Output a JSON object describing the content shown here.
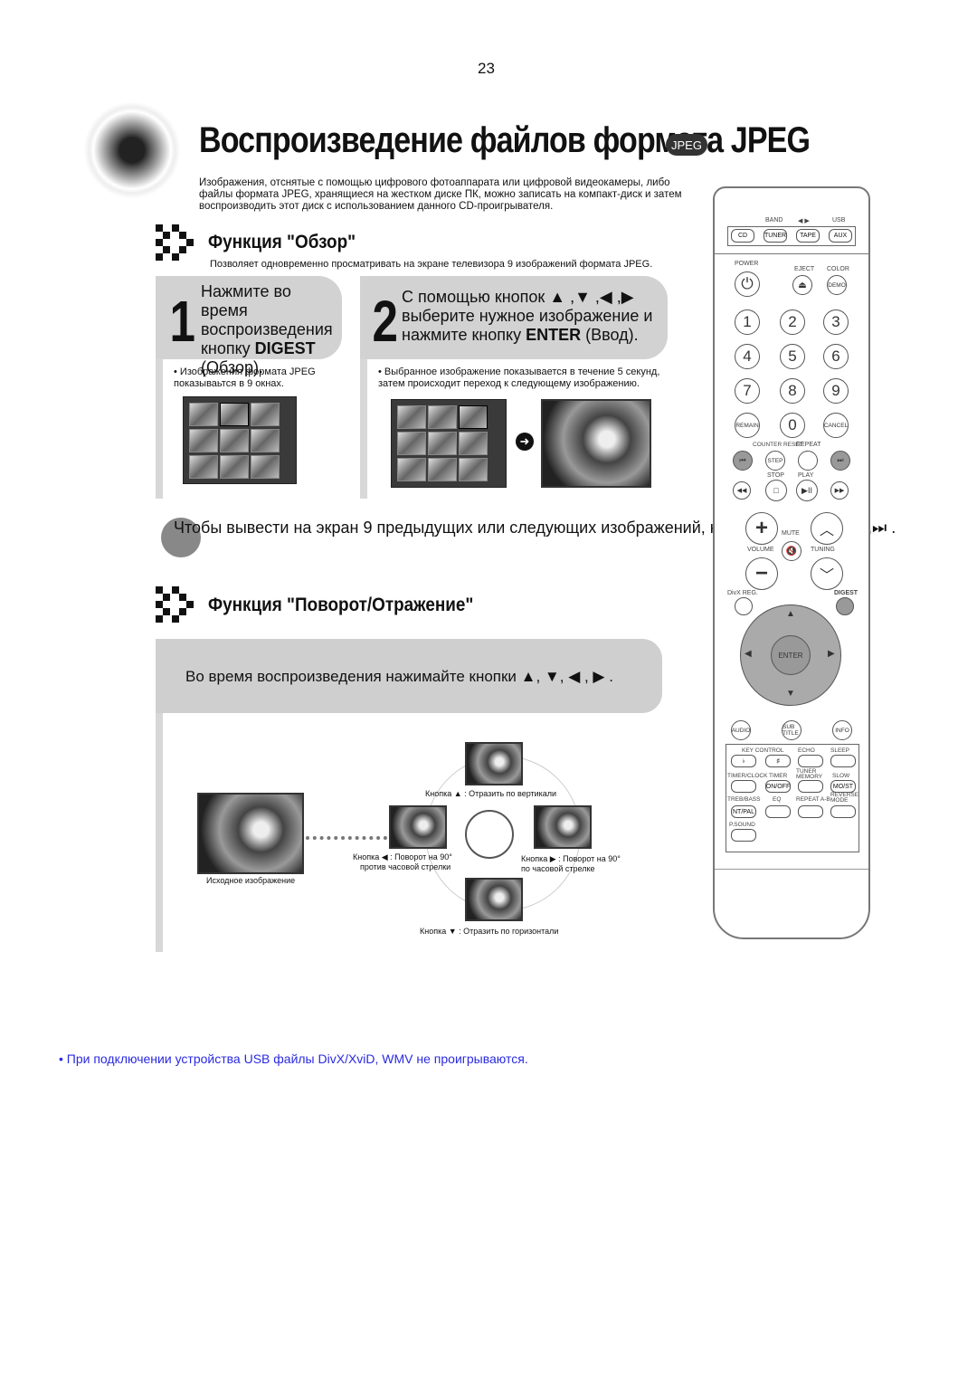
{
  "page_number": "23",
  "title": "Воспроизведение файлов формата JPEG",
  "title_badge": "JPEG",
  "intro": "Изображения, отснятые с помощью цифрового фотоаппарата или цифровой видеокамеры, либо файлы формата JPEG, хранящиеся на жестком диске ПК, можно записать на компакт-диск и затем воспроизводить этот диск с использованием данного CD-проигрывателя.",
  "digest_section": {
    "title": "Функция \"Обзор\"",
    "subtitle": "Позволяет одновременно просматривать на экране телевизора 9 изображений формата JPEG.",
    "steps": [
      {
        "number": "1",
        "text_a": "Нажмите во время воспроизведения кнопку ",
        "bold": "DIGEST",
        "text_b": " (Обзор).",
        "bullet": "Изображения формата JPEG показываьтся в 9 окнах."
      },
      {
        "number": "2",
        "text_a": "С помощью кнопок ▲ ,▼ ,◀ ,▶ выберите нужное изображение и нажмите кнопку ",
        "bold": "ENTER",
        "text_b": " (Ввод).",
        "bullet": "Выбранное изображение показывается в течение 5 секунд, затем происходит переход к следующему изображению."
      }
    ],
    "note": "Чтобы вывести на экран 9 предыдущих или следующих изображений, нажимайте кнопки ⏮,⏭ ."
  },
  "rotate_section": {
    "title": "Функция \"Поворот/Отражение\"",
    "instruction": "Во время воспроизведения нажимайте кнопки ▲, ▼, ◀ , ▶ .",
    "original_caption": "Исходное изображение",
    "captions": {
      "up": "Кнопка ▲ : Отразить по вертикали",
      "left_1": "Кнопка ◀ : Поворот на 90°",
      "left_2": "против часовой стрелки",
      "right_1": "Кнопка ▶ : Поворот на 90°",
      "right_2": "по часовой стрелке",
      "down": "Кнопка ▼ : Отразить по горизонтали"
    }
  },
  "footer_note": "При подключении устройства USB файлы DivX/XviD, WMV не проигрываются.",
  "colors": {
    "footer": "#2a2ae0",
    "step_box": "#d2d2d2"
  },
  "remote": {
    "top_labels": [
      "BAND",
      "◀ ▶",
      "USB"
    ],
    "source_buttons": [
      "CD",
      "TUNER",
      "TAPE",
      "AUX"
    ],
    "power_label": "POWER",
    "eject_label": "EJECT",
    "color_label": "COLOR",
    "demo": "DEMO",
    "digits": [
      "1",
      "2",
      "3",
      "4",
      "5",
      "6",
      "7",
      "8",
      "9"
    ],
    "remain": "REMAIN",
    "zero": "0",
    "cancel": "CANCEL",
    "counter_reset": "COUNTER RESET",
    "repeat": "REPEAT",
    "step": "STEP",
    "stop": "STOP",
    "play": "PLAY",
    "mute": "MUTE",
    "volume": "VOLUME",
    "tuning": "TUNING",
    "divx_reg": "DivX REG.",
    "digest": "DIGEST",
    "enter": "ENTER",
    "audio": "AUDIO",
    "subtitle": "SUB TITLE",
    "info": "INFO",
    "key_control": "KEY CONTROL",
    "echo": "ECHO",
    "sleep": "SLEEP",
    "timer_clock": "TIMER/CLOCK",
    "timer": "TIMER",
    "on_off": "ON/OFF",
    "tuner_memory": "TUNER MEMORY",
    "slow": "SLOW",
    "mo_st": "MO/ST",
    "treb_bass": "TREB/BASS",
    "eq": "EQ",
    "repeat_ab": "REPEAT A-B",
    "reverse_mode": "REVERSE MODE",
    "nt_pal": "NT/PAL",
    "p_sound": "P.SOUND"
  }
}
